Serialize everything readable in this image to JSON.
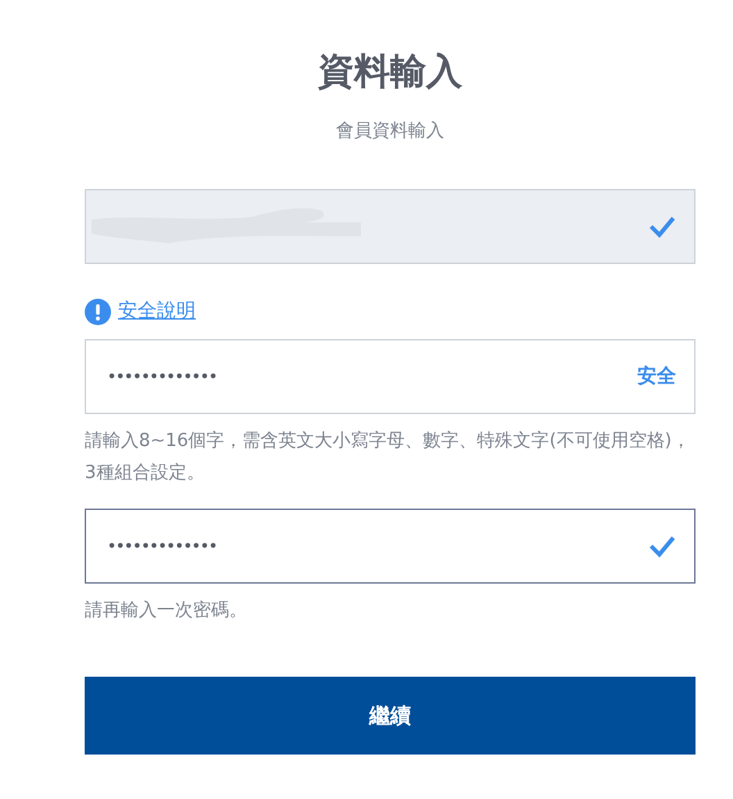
{
  "header": {
    "title": "資料輸入",
    "subtitle": "會員資料輸入"
  },
  "fields": [
    {
      "kind": "account",
      "disabled": true,
      "focused": false,
      "redacted": true,
      "valid": true
    },
    {
      "kind": "password",
      "disabled": false,
      "focused": false,
      "help_link": "安全說明",
      "value": "•••••••••••••",
      "strength": "安全",
      "hint": "請輸入8~16個字，需含英文大小寫字母、數字、特殊文字(不可使用空格)，3種組合設定。"
    },
    {
      "kind": "confirm",
      "disabled": false,
      "focused": true,
      "value": "•••••••••••••",
      "valid": true,
      "hint": "請再輸入一次密碼。"
    }
  ],
  "submit": {
    "label": "繼續"
  }
}
